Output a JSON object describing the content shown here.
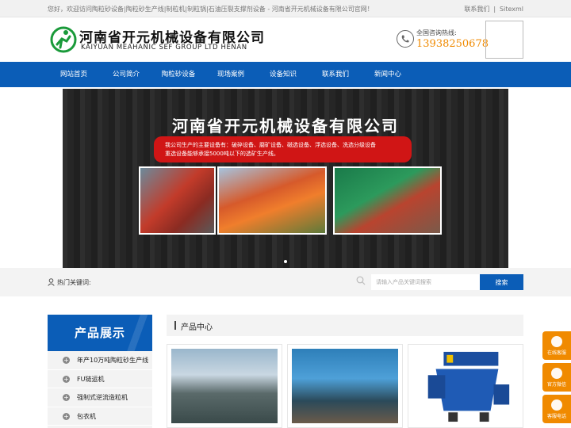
{
  "topbar": {
    "welcome": "您好，欢迎访问陶粒砂设备|陶粒砂生产线|制粒机|制粒锅|石油压裂支撑剂设备 - 河南省开元机械设备有限公司官网！",
    "links": [
      "联系我们",
      "Sitexml"
    ]
  },
  "header": {
    "logo_cn": "河南省开元机械设备有限公司",
    "logo_en": "KAIYUAN MEAHANIC SEF GROUP LTD HENAN",
    "hotline_label": "全国咨询热线:",
    "hotline_number": "13938250678"
  },
  "nav": [
    "网站首页",
    "公司简介",
    "陶粒砂设备",
    "现场案例",
    "设备知识",
    "联系我们",
    "新闻中心"
  ],
  "banner": {
    "title": "河南省开元机械设备有限公司",
    "line1": "我公司生产的主要设备有：破碎设备、磨矿设备、磁选设备、浮选设备、洗选分级设备",
    "line2": "重选设备能够承接5000吨以下的选矿生产线。"
  },
  "search": {
    "hot_label": "热门关键词:",
    "placeholder": "请输入产品关键词搜索",
    "button": "搜索"
  },
  "sidebar": {
    "title": "产品展示",
    "items": [
      "年产10万吨陶粒砂生产线",
      "FU链运机",
      "强制式逆流造粒机",
      "包衣机"
    ]
  },
  "center": {
    "title": "产品中心"
  },
  "float": [
    "在线客服",
    "官方微信",
    "客服电话"
  ],
  "colors": {
    "primary": "#0b5db7",
    "accent": "#f08a00",
    "banner_red": "#d01515"
  }
}
